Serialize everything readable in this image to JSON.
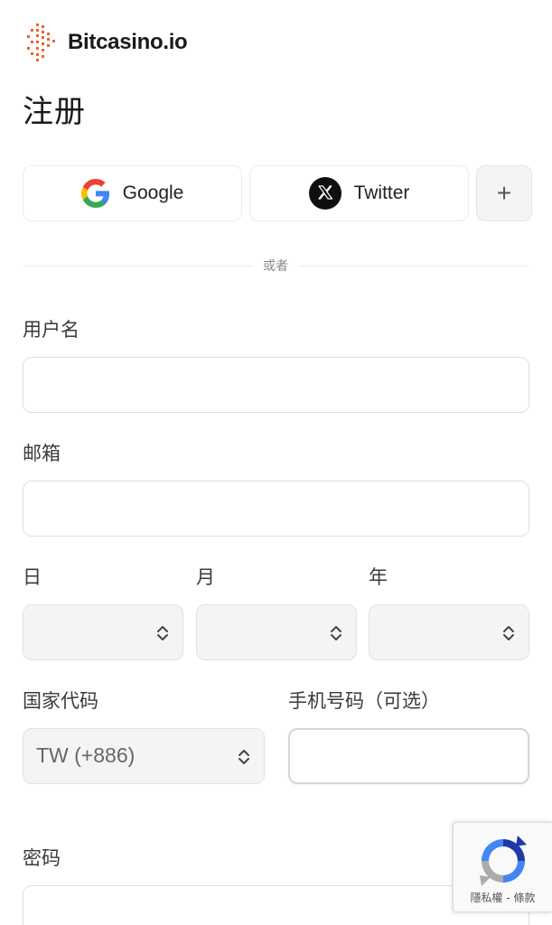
{
  "brand": {
    "name": "Bitcasino.io"
  },
  "page": {
    "title": "注册"
  },
  "social": {
    "google_label": "Google",
    "twitter_label": "Twitter",
    "more_label": "+"
  },
  "divider_text": "或者",
  "form": {
    "username_label": "用户名",
    "username_value": "",
    "email_label": "邮箱",
    "email_value": "",
    "dob": {
      "day_label": "日",
      "month_label": "月",
      "year_label": "年",
      "day_value": "",
      "month_value": "",
      "year_value": ""
    },
    "country_code_label": "国家代码",
    "country_code_value": "TW (+886)",
    "phone_label": "手机号码（可选）",
    "phone_value": "",
    "password_label": "密码"
  },
  "recaptcha": {
    "links": "隱私權 - 條款"
  },
  "colors": {
    "brand_orange": "#f0622a",
    "field_bg": "#f5f4f2",
    "border": "#dedede"
  }
}
